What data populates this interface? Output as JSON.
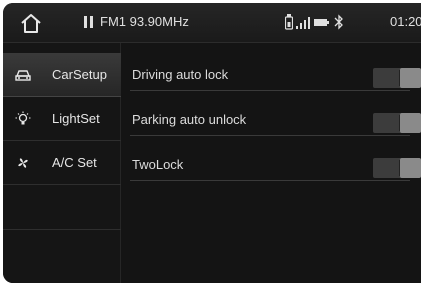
{
  "statusbar": {
    "home_icon": "home-icon",
    "pause_icon": "pause-icon",
    "radio_text": "FM1 93.90MHz",
    "status_icons": [
      "usb-icon",
      "signal-icon",
      "battery-icon",
      "bluetooth-icon"
    ],
    "clock": "01:20"
  },
  "sidebar": {
    "items": [
      {
        "label": "CarSetup",
        "icon": "car-icon",
        "active": true
      },
      {
        "label": "LightSet",
        "icon": "bulb-icon",
        "active": false
      },
      {
        "label": "A/C Set",
        "icon": "fan-icon",
        "active": false
      }
    ]
  },
  "settings": [
    {
      "label": "Driving auto lock",
      "state": "off"
    },
    {
      "label": "Parking auto unlock",
      "state": "off"
    },
    {
      "label": "TwoLock",
      "state": "off"
    }
  ],
  "colors": {
    "background": "#141414",
    "statusbar": "#222222",
    "active_item": "#333333",
    "text": "#e0e0e0",
    "toggle_track": "#3c3c3c",
    "toggle_knob": "#8a8a8a"
  }
}
